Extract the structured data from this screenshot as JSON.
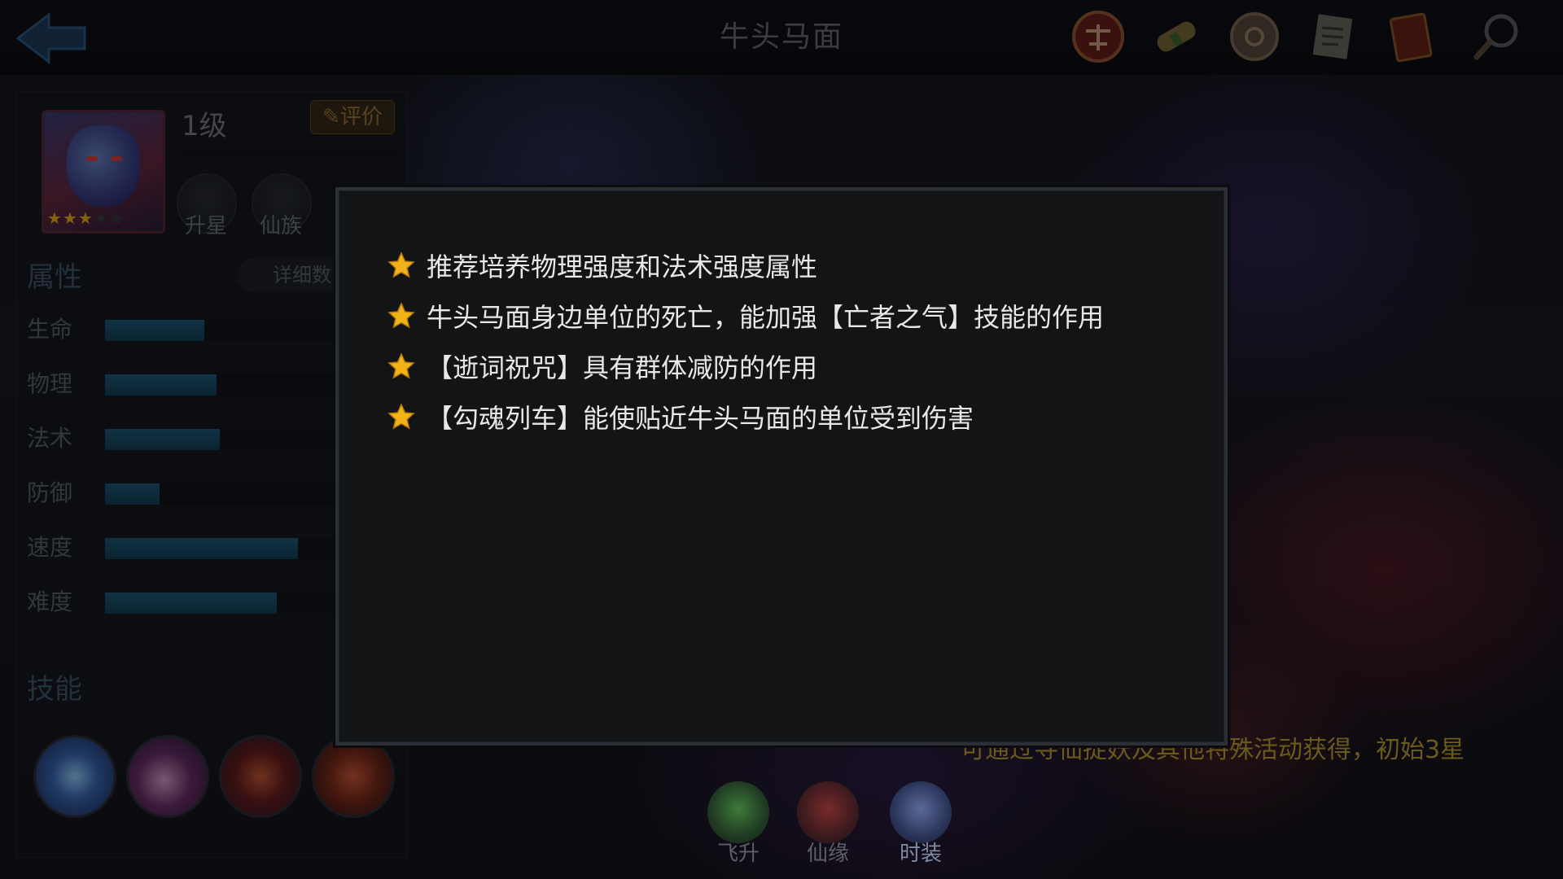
{
  "header": {
    "title": "牛头马面",
    "back_icon": "back-arrow-icon",
    "icons": [
      "trial-seal-icon",
      "scroll-icon",
      "coin-icon",
      "letter-icon",
      "book-icon",
      "magnifier-icon"
    ]
  },
  "hero": {
    "level": "1级",
    "rate_label": "评价",
    "stars_filled": 3,
    "stars_total": 5,
    "actions": [
      {
        "label": "升星",
        "icon": "star-up-icon"
      },
      {
        "label": "仙族",
        "icon": "clan-icon"
      }
    ]
  },
  "attributes": {
    "title": "属性",
    "detail_label": "详细数",
    "items": [
      {
        "label": "生命",
        "value": 0.33
      },
      {
        "label": "物理",
        "value": 0.37
      },
      {
        "label": "法术",
        "value": 0.38
      },
      {
        "label": "防御",
        "value": 0.18
      },
      {
        "label": "速度",
        "value": 0.64
      },
      {
        "label": "难度",
        "value": 0.57
      }
    ]
  },
  "skills": {
    "title": "技能",
    "icons": [
      "skill-burst-icon",
      "skill-vortex-icon",
      "skill-demon-icon",
      "skill-chain-icon"
    ]
  },
  "bottom": {
    "hint": "可通过寻仙捉妖及其他特殊活动获得，初始3星",
    "tabs": [
      {
        "label": "飞升",
        "icon": "ascend-icon"
      },
      {
        "label": "仙缘",
        "icon": "fate-icon"
      },
      {
        "label": "时装",
        "icon": "costume-icon"
      }
    ]
  },
  "tips_modal": {
    "items": [
      "推荐培养物理强度和法术强度属性",
      "牛头马面身边单位的死亡，能加强【亡者之气】技能的作用",
      "【逝词祝咒】具有群体减防的作用",
      "【勾魂列车】能使贴近牛头马面的单位受到伤害"
    ]
  },
  "colors": {
    "star": "#f1b318",
    "bar_fill": "#1f5d7e",
    "hint": "#6a5a1c",
    "modal_text": "#e8e8e8"
  }
}
